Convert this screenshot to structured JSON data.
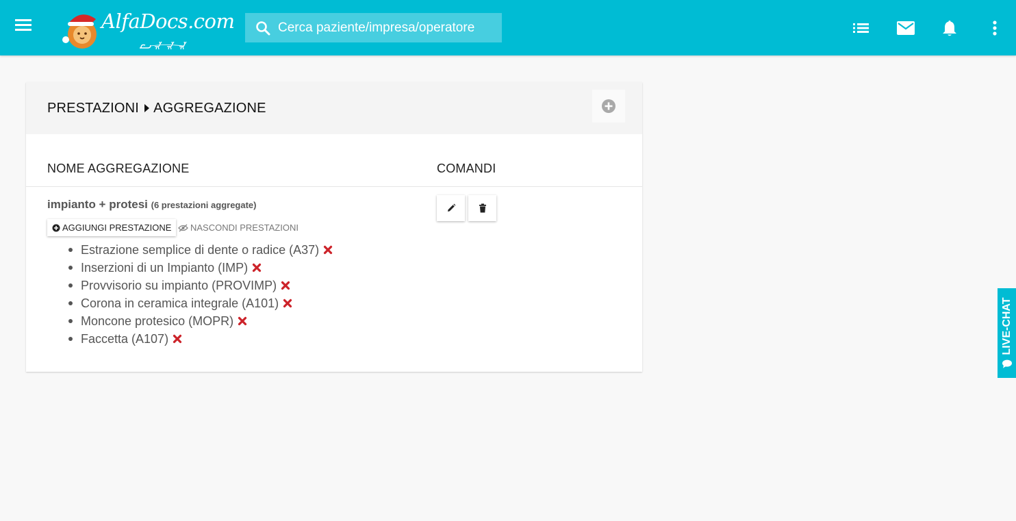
{
  "topbar": {
    "logo_text": "AlfaDocs.com",
    "search_placeholder": "Cerca paziente/impresa/operatore",
    "accent_color": "#00bcd4",
    "icons": [
      "menu-icon",
      "list-icon",
      "mail-icon",
      "bell-icon",
      "more-vert-icon"
    ]
  },
  "breadcrumb": {
    "root": "PRESTAZIONI",
    "current": "AGGREGAZIONE"
  },
  "table": {
    "col_name": "NOME AGGREGAZIONE",
    "col_commands": "COMANDI"
  },
  "aggregation": {
    "name": "impianto + protesi",
    "count_label": "(6 prestazioni aggregate)",
    "add_label": "AGGIUNGI PRESTAZIONE",
    "hide_label": "NASCONDI PRESTAZIONI",
    "items": [
      "Estrazione semplice di dente o radice (A37)",
      "Inserzioni di un Impianto (IMP)",
      "Provvisorio su impianto (PROVIMP)",
      "Corona in ceramica integrale (A101)",
      "Moncone protesico (MOPR)",
      "Faccetta (A107)"
    ]
  },
  "livechat": {
    "label": "LIVE-CHAT"
  }
}
